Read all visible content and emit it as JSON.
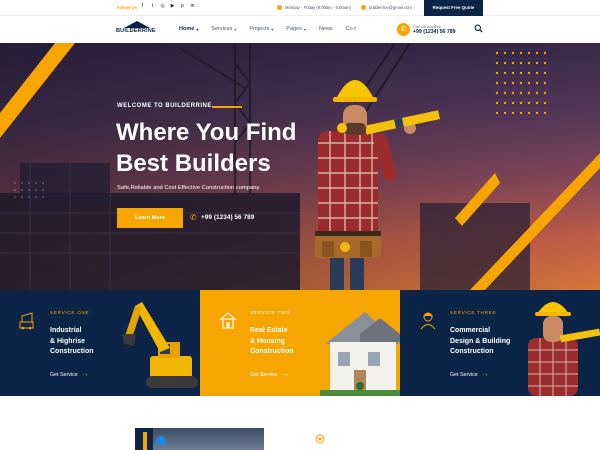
{
  "topbar": {
    "follow_label": "Follow Us",
    "social_icons": [
      "facebook-icon",
      "twitter-icon",
      "instagram-icon",
      "youtube-icon",
      "pinterest-icon",
      "linkedin-icon"
    ],
    "hours": "Monday - Friday (9:00am - 5:00am)",
    "email": "builderrine@gmail.com",
    "quote_button": "Request Free Quote"
  },
  "header": {
    "logo_text": "BUILDERRINE",
    "nav": [
      {
        "label": "Home",
        "has_dropdown": true,
        "active": true
      },
      {
        "label": "Services",
        "has_dropdown": true
      },
      {
        "label": "Projects",
        "has_dropdown": true
      },
      {
        "label": "Pages",
        "has_dropdown": true
      },
      {
        "label": "News",
        "has_dropdown": false
      },
      {
        "label": "Co t",
        "has_dropdown": false
      }
    ],
    "call_label": "Call Us Anytime",
    "call_number": "+99 (1234) 56 789"
  },
  "hero": {
    "welcome": "WELCOME TO BUILDERRINE",
    "headline_line1": "Where You Find",
    "headline_line2": "Best Builders",
    "tagline": "Safe,Reliable and Cost Effective Construction company.",
    "cta_label": "Learn More",
    "phone": "+99 (1234) 56 789"
  },
  "services": [
    {
      "label": "SERVICE ONE",
      "title_line1": "Industrial",
      "title_line2": "& Highrise",
      "title_line3": "Construction",
      "link": "Get Service"
    },
    {
      "label": "SERVICE TWO",
      "title_line1": "Real Estate",
      "title_line2": "& Housing",
      "title_line3": "Construction",
      "link": "Get Service"
    },
    {
      "label": "SERVICE THREE",
      "title_line1": "Commercial",
      "title_line2": "Design & Building",
      "title_line3": "Construction",
      "link": "Get Service"
    }
  ],
  "colors": {
    "brand_navy": "#0b2447",
    "brand_yellow": "#f7a500"
  }
}
